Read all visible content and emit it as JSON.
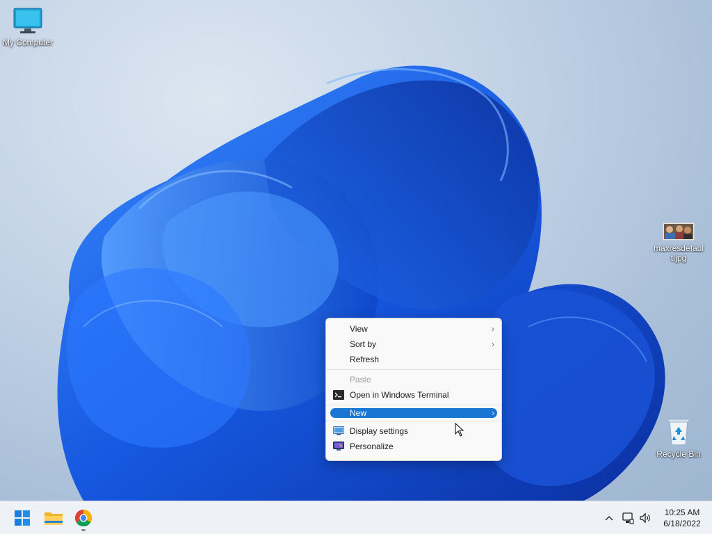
{
  "desktop": {
    "icons": [
      {
        "label": "My Computer",
        "icon": "computer-icon"
      },
      {
        "label_line1": "maxresdefaul",
        "label_line2": "t.jpg",
        "icon": "image-file-icon"
      },
      {
        "label": "Recycle Bin",
        "icon": "recycle-bin-icon"
      }
    ]
  },
  "context_menu": {
    "items": [
      {
        "label": "View",
        "has_submenu": true
      },
      {
        "label": "Sort by",
        "has_submenu": true
      },
      {
        "label": "Refresh"
      },
      {
        "label": "Paste",
        "disabled": true
      },
      {
        "label": "Open in Windows Terminal",
        "icon": "terminal-icon"
      },
      {
        "label": "New",
        "has_submenu": true,
        "highlighted": true
      },
      {
        "label": "Display settings",
        "icon": "display-icon"
      },
      {
        "label": "Personalize",
        "icon": "personalize-icon"
      }
    ],
    "submenu_glyph": "›"
  },
  "taskbar": {
    "apps": [
      {
        "name": "start",
        "icon": "windows-logo-icon"
      },
      {
        "name": "file-explorer",
        "icon": "folder-icon"
      },
      {
        "name": "chrome",
        "icon": "chrome-icon",
        "running": true
      }
    ],
    "tray": {
      "chevron_glyph": "^",
      "icons": [
        "show-hidden-icons-chevron",
        "network-icon",
        "volume-icon"
      ]
    },
    "clock": {
      "time": "10:25 AM",
      "date": "6/18/2022"
    }
  },
  "colors": {
    "accent": "#1976d2",
    "wallpaper_bloom": "#1a5fe0",
    "taskbar": "#eef2f7",
    "menu_bg": "#f9f9f9"
  }
}
